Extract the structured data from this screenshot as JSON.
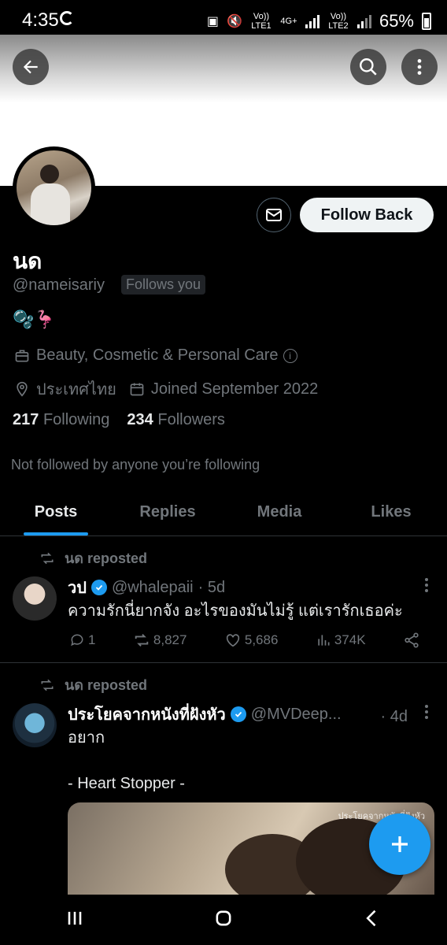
{
  "status_bar": {
    "time": "4:35",
    "network1": "Vo)) LTE1",
    "network2": "4G+",
    "network3": "Vo)) LTE2",
    "battery": "65%"
  },
  "profile": {
    "name": "นด",
    "handle": "@nameisariy",
    "follows_you": "Follows you",
    "bio": "🫧🦩",
    "category": "Beauty, Cosmetic & Personal Care",
    "location": "ประเทศไทย",
    "joined": "Joined September 2022",
    "following_count": "217",
    "following_label": "Following",
    "followers_count": "234",
    "followers_label": "Followers",
    "not_followed_note": "Not followed by anyone you’re following",
    "follow_back_label": "Follow Back"
  },
  "tabs": [
    {
      "label": "Posts"
    },
    {
      "label": "Replies"
    },
    {
      "label": "Media"
    },
    {
      "label": "Likes"
    }
  ],
  "posts": [
    {
      "repost_label": "นด reposted",
      "author": "วป",
      "handle": "@whalepaii",
      "time": "· 5d",
      "text": "ความรักนี่ยากจัง อะไรของมันไม่รู้ แต่เรารักเธอค่ะ",
      "replies": "1",
      "reposts": "8,827",
      "likes": "5,686",
      "views": "374K"
    },
    {
      "repost_label": "นด reposted",
      "author": "ประโยคจากหนังที่ฝังหัว",
      "handle": "@MVDeep...",
      "time": "· 4d",
      "text": "อยาก\n\n- Heart Stopper -",
      "media_watermark": "ประโยคจากหนังที่ฝังหัว"
    }
  ],
  "colors": {
    "accent": "#1d9bf0",
    "background": "#000000",
    "secondary_text": "#71767b"
  }
}
